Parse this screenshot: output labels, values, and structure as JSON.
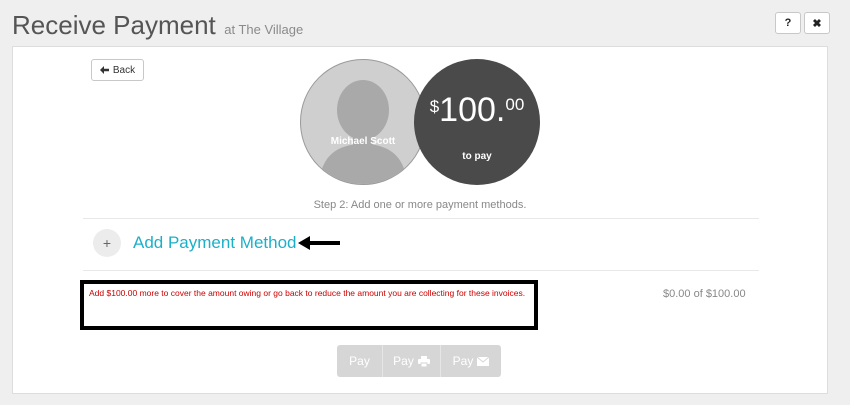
{
  "header": {
    "title": "Receive Payment",
    "subtitle": "at The Village",
    "help_label": "?",
    "close_label": "✖"
  },
  "back_button": {
    "label": "Back",
    "icon": "arrow-left-icon"
  },
  "customer": {
    "name": "Michael Scott"
  },
  "amount": {
    "currency": "$",
    "whole": "100.",
    "cents": "00",
    "caption": "to pay"
  },
  "step_text": "Step 2: Add one or more payment methods.",
  "add_method": {
    "plus": "+",
    "label": "Add Payment Method"
  },
  "warning": {
    "text": "Add $100.00 more to cover the amount owing or go back to reduce the amount you are collecting for these invoices."
  },
  "progress_text": "$0.00 of $100.00",
  "pay_buttons": [
    {
      "label": "Pay",
      "icon": ""
    },
    {
      "label": "Pay",
      "icon": "print-icon"
    },
    {
      "label": "Pay",
      "icon": "envelope-icon"
    }
  ],
  "colors": {
    "accent": "#1cb0c8",
    "warning": "#cc0000",
    "amount_bg": "#4a4a4a"
  }
}
